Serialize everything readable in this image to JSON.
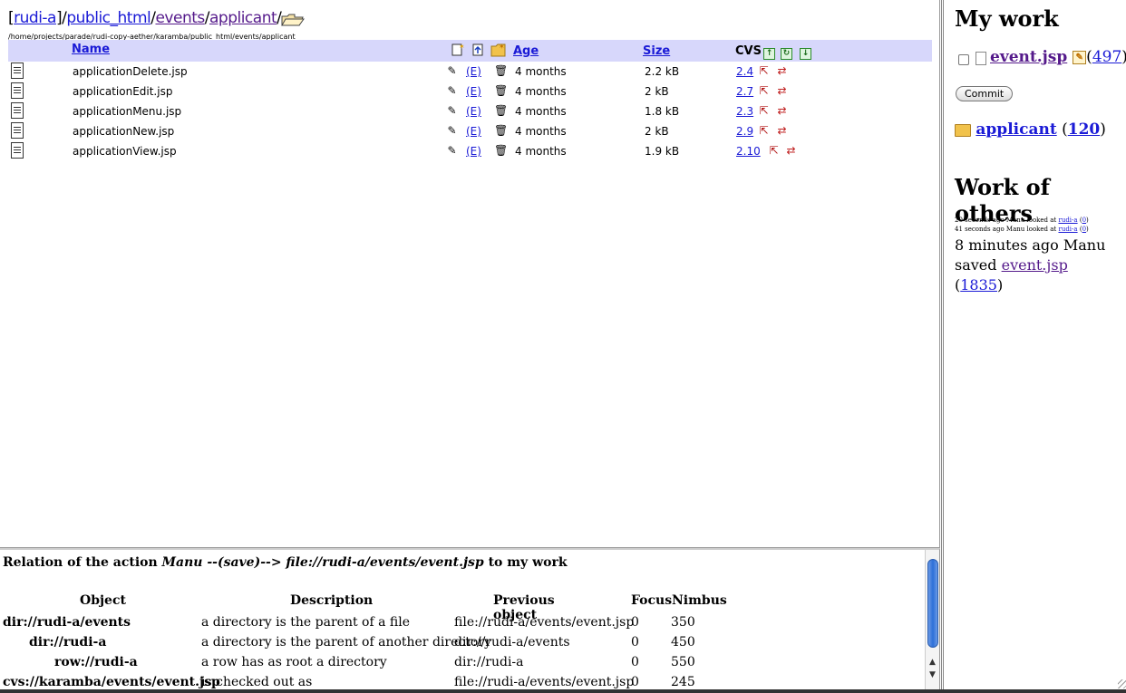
{
  "breadcrumb": {
    "open": "[",
    "root": "rudi-a",
    "close": "]",
    "sep": "/",
    "parts": [
      "public_html",
      "events",
      "applicant"
    ],
    "trail": "/"
  },
  "path": "/home/projects/parade/rudi-copy-aether/karamba/public_html/events/applicant",
  "listing": {
    "headers": {
      "name": "Name",
      "age": "Age",
      "size": "Size",
      "cvs": "CVS"
    },
    "rows": [
      {
        "name": "applicationDelete.jsp",
        "edit": "(E)",
        "age": "4 months",
        "size": "2.2 kB",
        "rev": "2.4"
      },
      {
        "name": "applicationEdit.jsp",
        "edit": "(E)",
        "age": "4 months",
        "size": "2 kB",
        "rev": "2.7"
      },
      {
        "name": "applicationMenu.jsp",
        "edit": "(E)",
        "age": "4 months",
        "size": "1.8 kB",
        "rev": "2.3"
      },
      {
        "name": "applicationNew.jsp",
        "edit": "(E)",
        "age": "4 months",
        "size": "2 kB",
        "rev": "2.9"
      },
      {
        "name": "applicationView.jsp",
        "edit": "(E)",
        "age": "4 months",
        "size": "1.9 kB",
        "rev": "2.10"
      }
    ]
  },
  "relation": {
    "title_pre": "Relation of the action",
    "title_action": "Manu --(save)--> file://rudi-a/events/event.jsp",
    "title_post": "to my work",
    "headers": {
      "object": "Object",
      "description": "Description",
      "previous": "Previous object",
      "focus": "Focus",
      "nimbus": "Nimbus"
    },
    "rows": [
      {
        "object": "dir://rudi-a/events",
        "description": "a directory is the parent of a file",
        "previous": "file://rudi-a/events/event.jsp",
        "focus": "0",
        "nimbus": "350"
      },
      {
        "object": "dir://rudi-a",
        "description": "a directory is the parent of another directory",
        "previous": "dir://rudi-a/events",
        "focus": "0",
        "nimbus": "450"
      },
      {
        "object": "row://rudi-a",
        "description": "a row has as root a directory",
        "previous": "dir://rudi-a",
        "focus": "0",
        "nimbus": "550"
      },
      {
        "object": "cvs://karamba/events/event.jsp",
        "description": "is checked out as",
        "previous": "file://rudi-a/events/event.jsp",
        "focus": "0",
        "nimbus": "245"
      }
    ]
  },
  "side": {
    "my_work_title": "My work",
    "work_file": "event.jsp",
    "work_file_count": "497",
    "commit_label": "Commit",
    "folder": "applicant",
    "folder_count": "120",
    "others_title": "Work of others",
    "activity": [
      {
        "text": "20 seconds ago Manu looked at",
        "link": "rudi-a",
        "count": "0"
      },
      {
        "text": "41 seconds ago Manu looked at",
        "link": "rudi-a",
        "count": "0"
      }
    ],
    "latest": {
      "text": "8 minutes ago Manu saved",
      "link": "event.jsp",
      "count": "1835"
    }
  },
  "colors": {
    "link": "#1a1ad6",
    "visited": "#551a8b",
    "header_bg": "#d7d7fb"
  }
}
